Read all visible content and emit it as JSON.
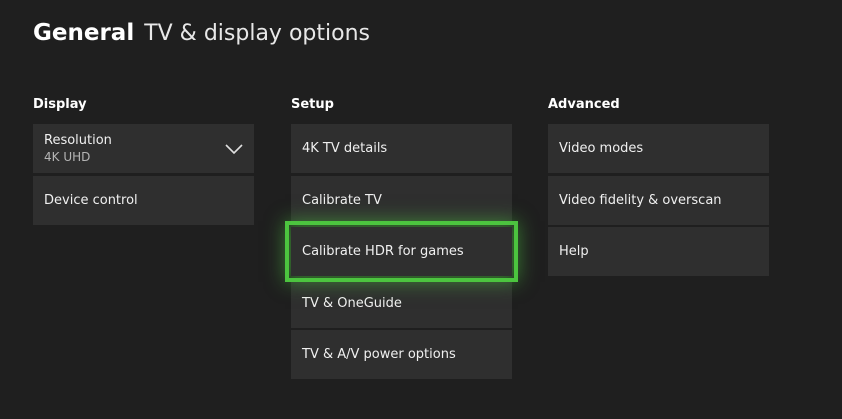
{
  "header": {
    "section": "General",
    "title": "TV & display options"
  },
  "display": {
    "heading": "Display",
    "resolution": {
      "label": "Resolution",
      "value": "4K UHD",
      "icon": "chevron-down-icon"
    },
    "device_control": "Device control"
  },
  "setup": {
    "heading": "Setup",
    "items": [
      "4K TV details",
      "Calibrate TV",
      "Calibrate HDR for games",
      "TV & OneGuide",
      "TV & A/V power options"
    ],
    "focused_item": "Calibrate HDR for games"
  },
  "advanced": {
    "heading": "Advanced",
    "items": [
      "Video modes",
      "Video fidelity & overscan",
      "Help"
    ]
  },
  "colors": {
    "background": "#1f1f1f",
    "tile": "#2f2f2f",
    "focus": "#4cc43f"
  }
}
